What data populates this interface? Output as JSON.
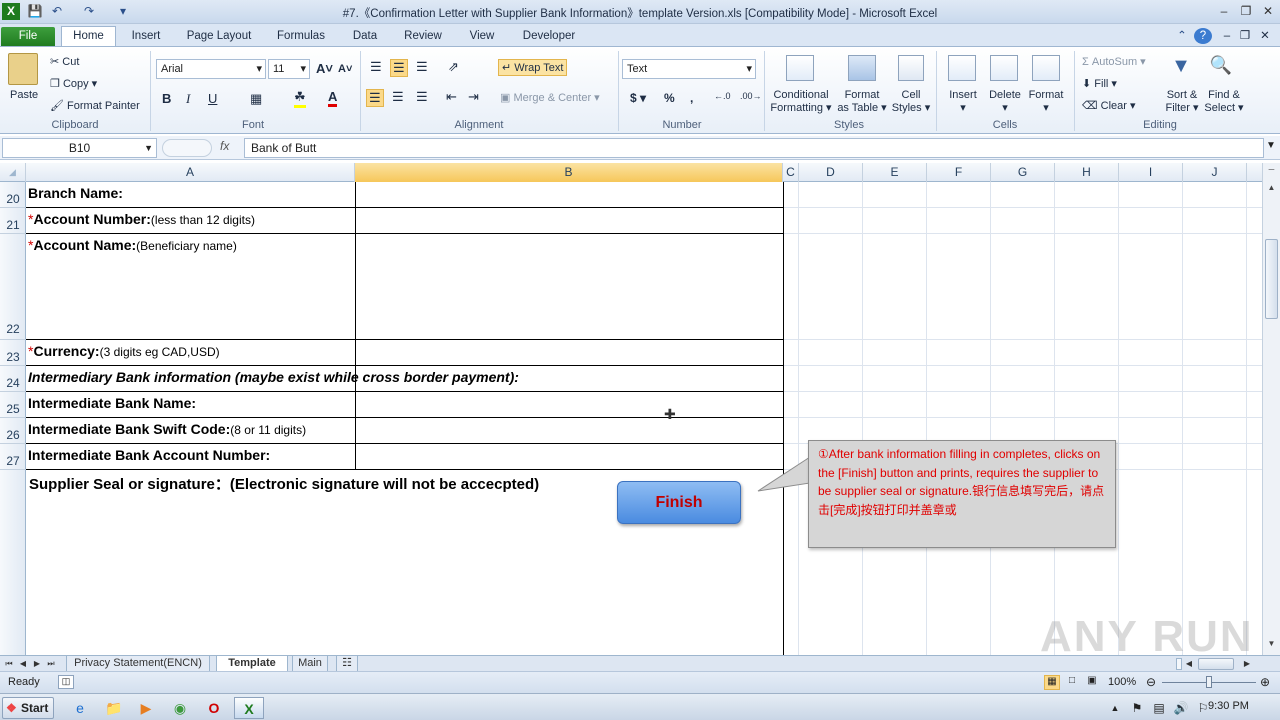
{
  "window": {
    "title": "#7.《Confirmation Letter with Supplier Bank Information》template Version.xls  [Compatibility Mode]  -  Microsoft Excel"
  },
  "tabs": [
    "File",
    "Home",
    "Insert",
    "Page Layout",
    "Formulas",
    "Data",
    "Review",
    "View",
    "Developer"
  ],
  "ribbon": {
    "clipboard": {
      "paste": "Paste",
      "cut": "Cut",
      "copy": "Copy",
      "format_painter": "Format Painter",
      "label": "Clipboard"
    },
    "font": {
      "name": "Arial",
      "size": "11",
      "label": "Font"
    },
    "alignment": {
      "wrap": "Wrap Text",
      "merge": "Merge & Center",
      "label": "Alignment"
    },
    "number": {
      "format": "Text",
      "label": "Number"
    },
    "styles": {
      "conditional": "Conditional",
      "conditional2": "Formatting",
      "format_table": "Format",
      "format_table2": "as Table",
      "cell_styles": "Cell",
      "cell_styles2": "Styles",
      "label": "Styles"
    },
    "cells": {
      "insert": "Insert",
      "delete": "Delete",
      "format": "Format",
      "label": "Cells"
    },
    "editing": {
      "autosum": "AutoSum",
      "fill": "Fill",
      "clear": "Clear",
      "sort": "Sort &",
      "sort2": "Filter",
      "find": "Find &",
      "find2": "Select",
      "label": "Editing"
    }
  },
  "formula_bar": {
    "name_box": "B10",
    "fx": "fx",
    "content": "Bank of Butt"
  },
  "columns": [
    "A",
    "B",
    "C",
    "D",
    "E",
    "F",
    "G",
    "H",
    "I",
    "J"
  ],
  "rows": [
    "20",
    "21",
    "22",
    "23",
    "24",
    "25",
    "26",
    "27"
  ],
  "cells": {
    "r20": {
      "label": "Branch Name:"
    },
    "r21": {
      "star": "*",
      "label": "Account Number:",
      "note": "(less than 12 digits)"
    },
    "r22": {
      "star": "*",
      "label": "Account Name:",
      "note": "(Beneficiary name)"
    },
    "r23": {
      "star": "*",
      "label": "Currency:",
      "note": "(3 digits eg CAD,USD)"
    },
    "r24": {
      "label": "Intermediary Bank information (maybe exist while cross border payment):"
    },
    "r25": {
      "label": "Intermediate Bank Name:"
    },
    "r26": {
      "label": "Intermediate Bank Swift Code:",
      "note": "(8 or 11 digits)"
    },
    "r27": {
      "label": "Intermediate Bank Account Number:"
    },
    "seal": "Supplier Seal or signature：(Electronic signature will not be accecpted)"
  },
  "finish_button": "Finish",
  "callout": {
    "line1": "①After bank information filling in completes, clicks on the [Finish] button and prints, requires the supplier to be supplier seal or signature.银行信息填写完后，请点击[完成]按钮打印并盖章或"
  },
  "sheet_tabs": [
    "Privacy Statement(ENCN)",
    "Template",
    "Main"
  ],
  "status": {
    "ready": "Ready",
    "zoom": "100%"
  },
  "taskbar": {
    "start": "Start",
    "time": "9:30 PM"
  },
  "watermark": "ANY RUN"
}
